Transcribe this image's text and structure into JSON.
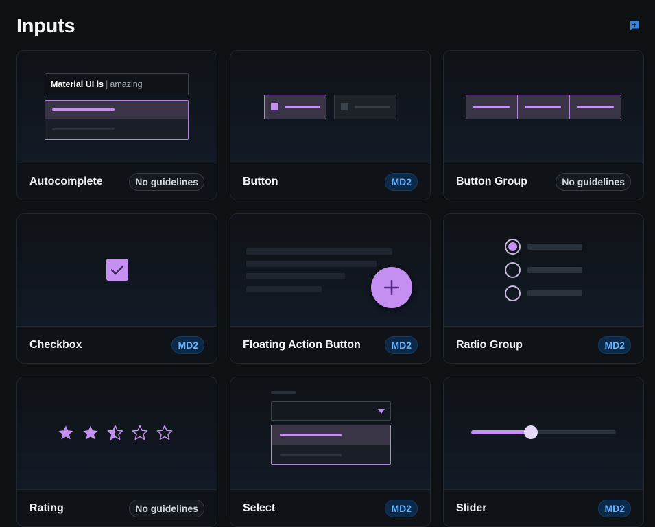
{
  "header": {
    "title": "Inputs",
    "feedback_icon": "add-comment-icon"
  },
  "colors": {
    "accent": "#c68ff2",
    "background": "#0e1114",
    "md2_badge_text": "#66b2ff",
    "md2_badge_bg": "#0b2948"
  },
  "cards": [
    {
      "name": "Autocomplete",
      "badge": "No guidelines",
      "preview": {
        "input_typed": "Material UI is",
        "input_caret": "|",
        "input_suggestion": "amazing"
      }
    },
    {
      "name": "Button",
      "badge": "MD2"
    },
    {
      "name": "Button Group",
      "badge": "No guidelines"
    },
    {
      "name": "Checkbox",
      "badge": "MD2",
      "preview": {
        "checked": true,
        "icon": "check-icon"
      }
    },
    {
      "name": "Floating Action Button",
      "badge": "MD2",
      "preview": {
        "icon": "plus-icon"
      }
    },
    {
      "name": "Radio Group",
      "badge": "MD2",
      "preview": {
        "selected_index": 0,
        "option_count": 3
      }
    },
    {
      "name": "Rating",
      "badge": "No guidelines",
      "preview": {
        "value": 2.5,
        "max": 5,
        "icon": "star-icon"
      }
    },
    {
      "name": "Select",
      "badge": "MD2",
      "preview": {
        "icon": "caret-down-icon"
      }
    },
    {
      "name": "Slider",
      "badge": "MD2",
      "preview": {
        "value_fraction": 0.41
      }
    }
  ]
}
